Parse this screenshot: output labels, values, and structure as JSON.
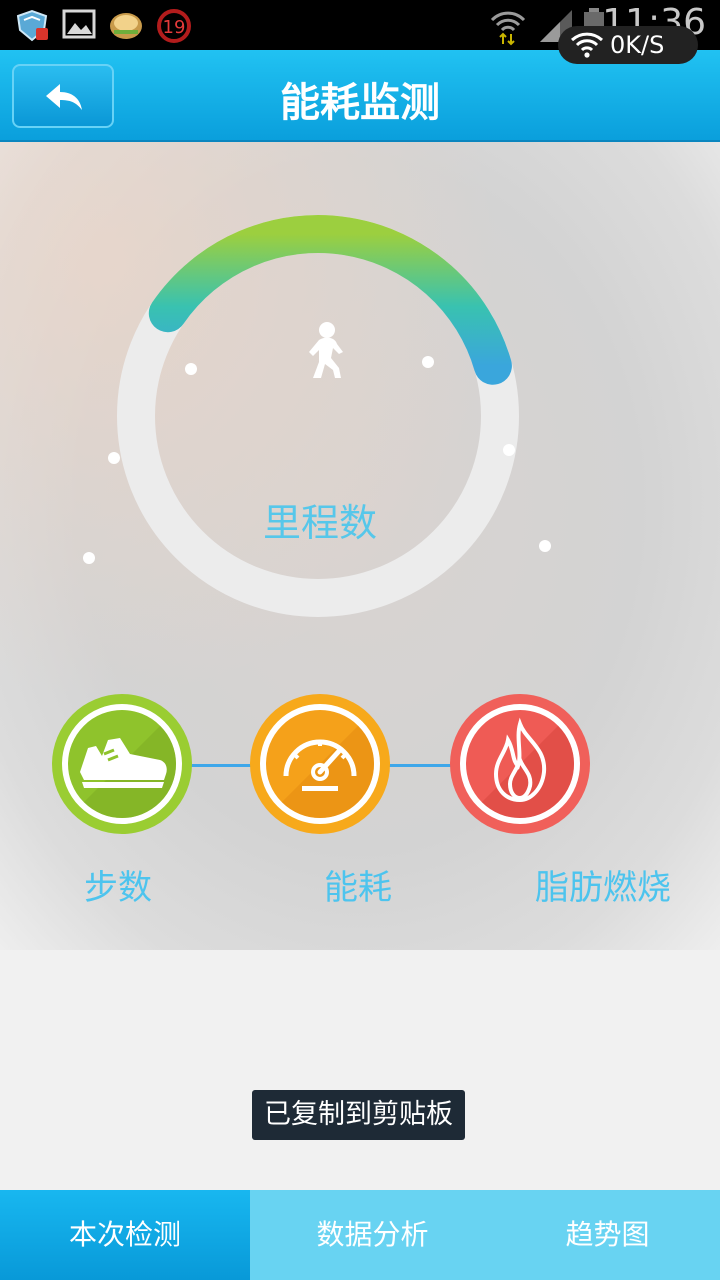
{
  "status_bar": {
    "time": "11:36",
    "net_speed": "0K/S",
    "notification_badge": "19",
    "icons": [
      "shield-icon",
      "gallery-icon",
      "food-app-icon",
      "badge-19-icon",
      "wifi-data-icon",
      "signal-icon",
      "battery-icon",
      "wifi-icon"
    ]
  },
  "header": {
    "title": "能耗监测",
    "back_icon": "back-arrow-icon"
  },
  "gauge": {
    "label": "里程数",
    "icon": "walking-person-icon",
    "progress_fraction": 0.36
  },
  "features": [
    {
      "label": "步数",
      "icon": "sneaker-icon",
      "color": "#9acd32"
    },
    {
      "label": "能耗",
      "icon": "speedometer-icon",
      "color": "#f7a91b"
    },
    {
      "label": "脂肪燃烧",
      "icon": "flame-icon",
      "color": "#f0605a"
    }
  ],
  "toast": "已复制到剪贴板",
  "tabs": [
    {
      "label": "本次检测",
      "active": true
    },
    {
      "label": "数据分析",
      "active": false
    },
    {
      "label": "趋势图",
      "active": false
    }
  ],
  "colors": {
    "accent": "#0a9fdc",
    "tab_bar": "#68d3f2",
    "gauge_green": "#9ccf3f",
    "gauge_blue": "#3aa6dc",
    "label_blue": "#4dc4ee"
  }
}
